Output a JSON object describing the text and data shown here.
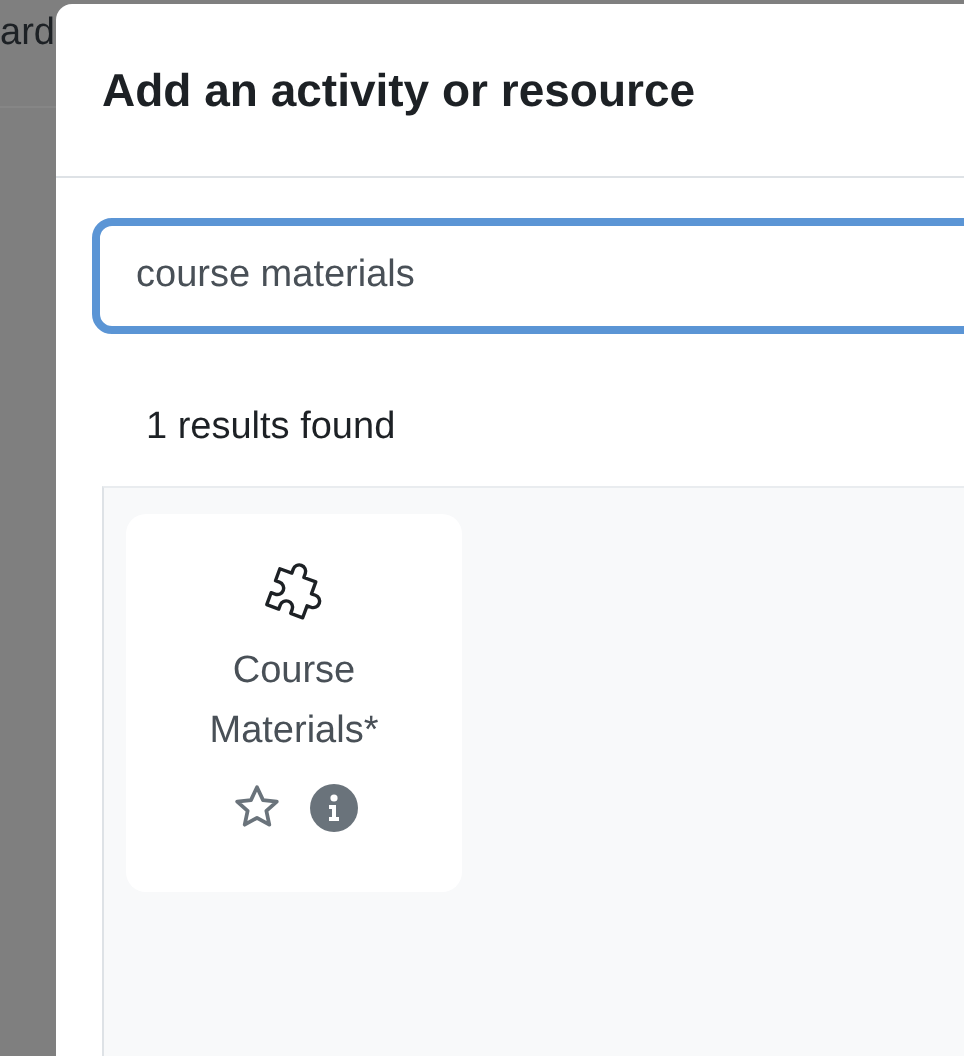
{
  "background_page": {
    "text": "ard"
  },
  "dialog": {
    "title": "Add an activity or resource",
    "search": {
      "value": "course materials"
    },
    "results_count": "1 results found",
    "results": [
      {
        "name": "Course Materials*",
        "starred": false
      }
    ]
  }
}
